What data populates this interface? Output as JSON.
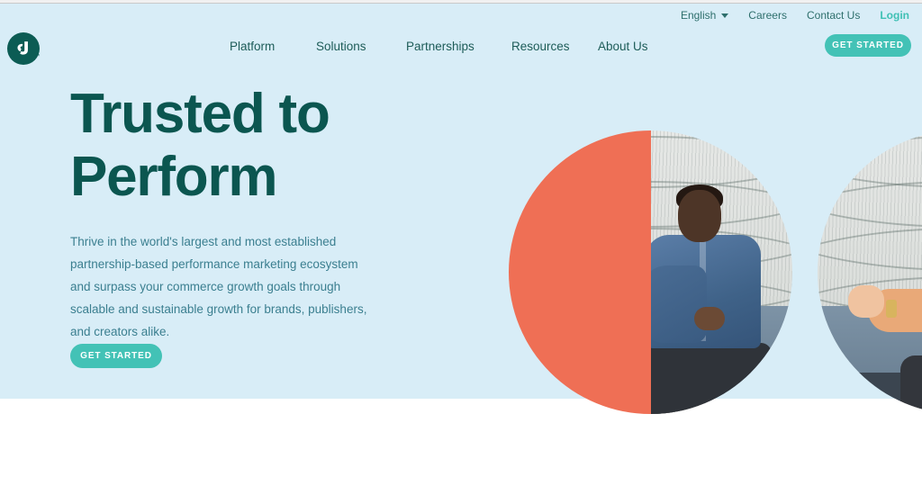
{
  "brand": {
    "logo_icon": "cj-monogram-logo",
    "trademark": "™",
    "colors": {
      "hero_background": "#d8edf7",
      "heading": "#0b5650",
      "accent_teal": "#43c2b6",
      "coral": "#ef6f55",
      "nav_text": "#1d5c58",
      "body_text": "#3b7f90",
      "logo_circle": "#0c5c54"
    }
  },
  "utility_bar": {
    "language": {
      "label": "English",
      "caret_icon": "chevron-down-icon"
    },
    "links": [
      {
        "label": "Careers"
      },
      {
        "label": "Contact Us"
      }
    ],
    "login": {
      "label": "Login"
    }
  },
  "main_nav": {
    "items": [
      {
        "label": "Platform"
      },
      {
        "label": "Solutions"
      },
      {
        "label": "Partnerships"
      },
      {
        "label": "Resources"
      },
      {
        "label": "About Us"
      }
    ],
    "cta": {
      "label": "GET STARTED"
    }
  },
  "hero": {
    "title": "Trusted to\nPerform",
    "subtitle": "Thrive in the world's largest and most established partnership-based performance marketing ecosystem and surpass your commerce growth goals through scalable and sustainable growth for brands, publishers, and creators alike.",
    "cta": {
      "label": "GET STARTED"
    },
    "artwork": {
      "circle_one": "coral-half-and-photo-circle",
      "circle_two": "photo-circle",
      "photo_description": "two people seated on a sofa in conversation"
    }
  }
}
